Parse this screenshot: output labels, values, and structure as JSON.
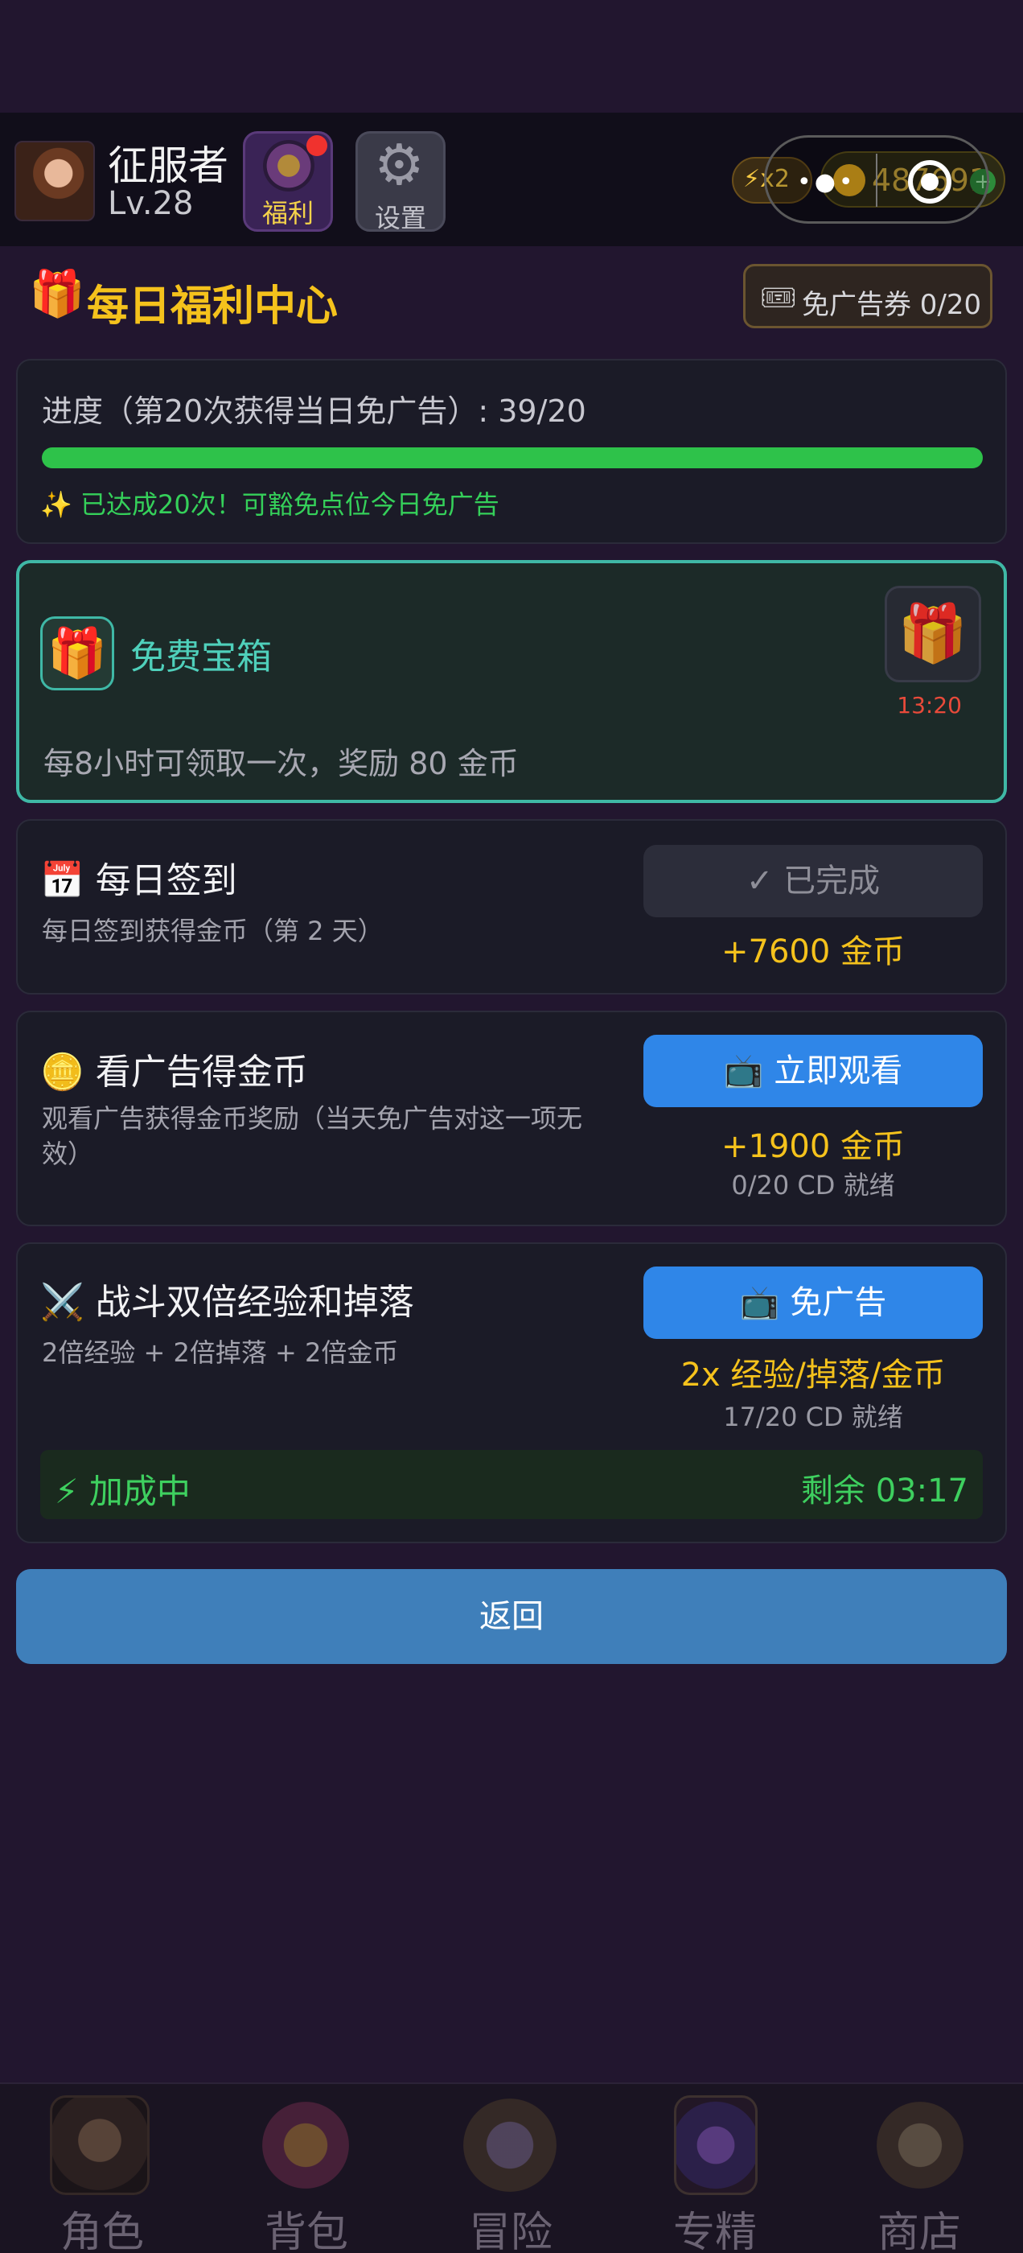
{
  "header": {
    "player_name": "征服者",
    "player_level": "Lv.28",
    "welfare_label": "福利",
    "settings_label": "设置",
    "energy": "⚡x2",
    "coins": "487691",
    "coin_plus": "+",
    "capsule_dots": "•●•"
  },
  "title": {
    "icon": "🎁",
    "text": "每日福利中心",
    "ticket_icon": "🎟",
    "ticket_text": "免广告券 0/20"
  },
  "progress": {
    "text": "进度（第20次获得当日免广告）: 39/20",
    "fill_fraction": 1.0,
    "note": "✨ 已达成20次！可豁免点位今日免广告"
  },
  "chest": {
    "icon": "🎁",
    "title": "免费宝箱",
    "box_icon": "🎁",
    "timer": "13:20",
    "desc": "每8小时可领取一次，奖励 80 金币"
  },
  "signin": {
    "title": "📅 每日签到",
    "desc": "每日签到获得金币（第 2 天）",
    "button": "✓ 已完成",
    "reward": "+7600 金币"
  },
  "ad": {
    "title": "🪙 看广告得金币",
    "desc": "观看广告获得金币奖励（当天免广告对这一项无效）",
    "button": "📺 立即观看",
    "reward": "+1900 金币",
    "meta": "0/20  CD 就绪"
  },
  "battle": {
    "title": "⚔️ 战斗双倍经验和掉落",
    "desc": "2倍经验 + 2倍掉落 + 2倍金币",
    "button": "📺 免广告",
    "reward": "2x 经验/掉落/金币",
    "meta": "17/20  CD 就绪",
    "boost_label": "⚡ 加成中",
    "boost_remaining": "剩余 03:17"
  },
  "back_button": "返回",
  "nav": [
    {
      "label": "角色",
      "icon": "warrior-icon"
    },
    {
      "label": "背包",
      "icon": "bag-icon"
    },
    {
      "label": "冒险",
      "icon": "swords-icon"
    },
    {
      "label": "专精",
      "icon": "spellbook-icon"
    },
    {
      "label": "商店",
      "icon": "shop-icon"
    }
  ],
  "colors": {
    "background": "#22162f",
    "accent_gold": "#f5c21c",
    "accent_green": "#2ec24a",
    "accent_teal": "#3fb8a6",
    "button_blue": "#2f86e8",
    "back_blue": "#3f7fba"
  }
}
